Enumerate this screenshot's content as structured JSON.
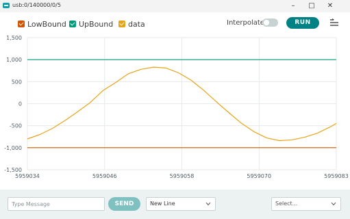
{
  "window": {
    "title": "usb:0/140000/0/5"
  },
  "legend": [
    {
      "label": "LowBound",
      "color": "#d35400"
    },
    {
      "label": "UpBound",
      "color": "#009c7a"
    },
    {
      "label": "data",
      "color": "#e8a317"
    }
  ],
  "toolbar": {
    "interpolate_label": "Interpolate",
    "interpolate_on": false,
    "run_label": "RUN"
  },
  "footer": {
    "message_placeholder": "Type Message",
    "send_label": "SEND",
    "line_ending": "New Line",
    "baud_placeholder": "Select..."
  },
  "chart_data": {
    "type": "line",
    "x_ticks": [
      "5959034",
      "5959046",
      "5959058",
      "5959070",
      "5959083"
    ],
    "y_ticks": [
      "1,500",
      "1,000",
      "500",
      "0",
      "-500",
      "-1,000",
      "-1,500"
    ],
    "xlim": [
      5959034,
      5959083
    ],
    "ylim": [
      -1500,
      1500
    ],
    "grid": true,
    "series": [
      {
        "name": "LowBound",
        "color": "#d35400",
        "x": [
          5959034,
          5959083
        ],
        "y": [
          -1000,
          -1000
        ]
      },
      {
        "name": "UpBound",
        "color": "#009c7a",
        "x": [
          5959034,
          5959083
        ],
        "y": [
          1000,
          1000
        ]
      },
      {
        "name": "data",
        "color": "#e8a317",
        "x": [
          5959034,
          5959036,
          5959038,
          5959040,
          5959042,
          5959044,
          5959046,
          5959048,
          5959050,
          5959052,
          5959054,
          5959056,
          5959058,
          5959060,
          5959062,
          5959064,
          5959066,
          5959068,
          5959070,
          5959072,
          5959074,
          5959076,
          5959078,
          5959080,
          5959082,
          5959083
        ],
        "y": [
          -800,
          -700,
          -560,
          -380,
          -180,
          30,
          300,
          480,
          680,
          780,
          830,
          810,
          700,
          530,
          300,
          40,
          -210,
          -450,
          -640,
          -780,
          -840,
          -820,
          -760,
          -670,
          -530,
          -450
        ]
      }
    ]
  }
}
